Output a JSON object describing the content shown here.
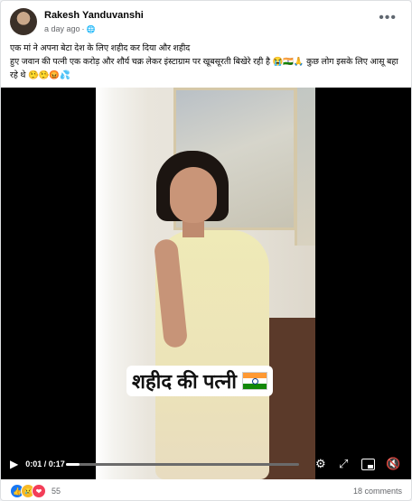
{
  "post": {
    "author": "Rakesh Yanduvanshi",
    "timestamp": "a day ago",
    "meta_separator": "·",
    "privacy_icon": "globe-icon",
    "more_label": "•••",
    "text_line1": "एक मां ने अपना बेटा देश के लिए शहीद कर दिया और शहीद",
    "text_line2": "हुए जवान की पत्नी एक करोड़ और शौर्य चक्र लेकर इंस्टाग्राम पर खूबसूरती बिखेरे रही है 😭🇮🇳🙏 कुछ लोग इसके लिए आसू बहा रहे थे 🤥🤥😡💦"
  },
  "video": {
    "caption": "शहीद की पत्नी",
    "current_time": "0:01",
    "duration": "0:17",
    "progress": 0.06,
    "play_icon": "▶",
    "settings_icon": "⚙",
    "expand_icon": "⤢",
    "mute_icon": "🔇"
  },
  "engagement": {
    "reaction_icons": [
      "👍",
      "😢",
      "❤"
    ],
    "reaction_count": "55",
    "comments": "18 comments"
  },
  "colors": {
    "facebook_blue": "#1877f2",
    "meta_gray": "#65676b",
    "flag_saffron": "#ff9933",
    "flag_green": "#138808"
  }
}
